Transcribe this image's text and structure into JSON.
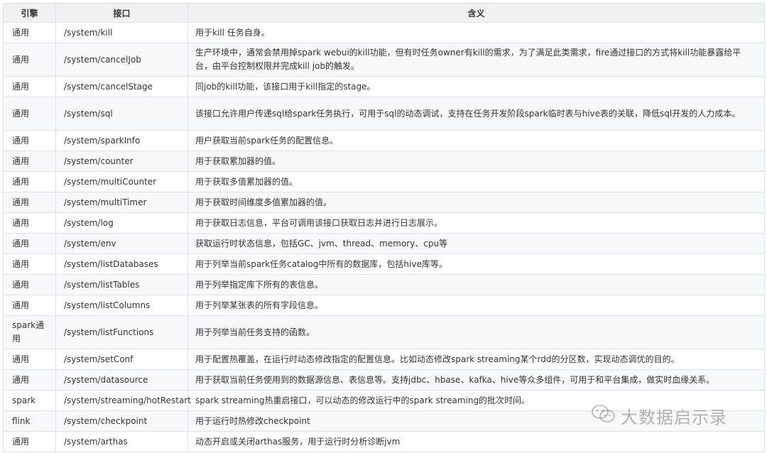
{
  "table": {
    "headers": [
      "引擎",
      "接口",
      "含义"
    ],
    "rows": [
      {
        "engine": "通用",
        "api": "/system/kill",
        "desc": "用于kill 任务自身。"
      },
      {
        "engine": "通用",
        "api": "/system/cancelJob",
        "desc": "生产环境中，通常会禁用掉spark webui的kill功能，但有时任务owner有kill的需求，为了满足此类需求，fire通过接口的方式将kill功能暴露给平台，由平台控制权限并完成kill job的触发。"
      },
      {
        "engine": "通用",
        "api": "/system/cancelStage",
        "desc": "同job的kill功能，该接口用于kill指定的stage。"
      },
      {
        "engine": "通用",
        "api": "/system/sql",
        "desc": "该接口允许用户传递sql给spark任务执行，可用于sql的动态调试，支持在任务开发阶段spark临时表与hive表的关联，降低sql开发的人力成本。"
      },
      {
        "engine": "通用",
        "api": "/system/sparkInfo",
        "desc": "用户获取当前spark任务的配置信息。"
      },
      {
        "engine": "通用",
        "api": "/system/counter",
        "desc": "用于获取累加器的值。"
      },
      {
        "engine": "通用",
        "api": "/system/multiCounter",
        "desc": "用于获取多值累加器的值。"
      },
      {
        "engine": "通用",
        "api": "/system/multiTimer",
        "desc": "用于获取时间维度多值累加器的值。"
      },
      {
        "engine": "通用",
        "api": "/system/log",
        "desc": "用于获取日志信息，平台可调用该接口获取日志并进行日志展示。"
      },
      {
        "engine": "通用",
        "api": "/system/env",
        "desc": "获取运行时状态信息，包括GC、jvm、thread、memory、cpu等"
      },
      {
        "engine": "通用",
        "api": "/system/listDatabases",
        "desc": "用于列举当前spark任务catalog中所有的数据库，包括hive库等。"
      },
      {
        "engine": "通用",
        "api": "/system/listTables",
        "desc": "用于列举指定库下所有的表信息。"
      },
      {
        "engine": "通用",
        "api": "/system/listColumns",
        "desc": "用于列举某张表的所有字段信息。"
      },
      {
        "engine": "spark通用",
        "api": "/system/listFunctions",
        "desc": "用于列举当前任务支持的函数。"
      },
      {
        "engine": "通用",
        "api": "/system/setConf",
        "desc": "用于配置热覆盖，在运行时动态修改指定的配置信息。比如动态修改spark streaming某个rdd的分区数，实现动态调优的目的。"
      },
      {
        "engine": "通用",
        "api": "/system/datasource",
        "desc": "用于获取当前任务使用到的数据源信息、表信息等。支持jdbc、hbase、kafka、hive等众多组件，可用于和平台集成，做实时血缘关系。"
      },
      {
        "engine": "spark",
        "api": "/system/streaming/hotRestart",
        "desc": "spark streaming热重启接口，可以动态的修改运行中的spark streaming的批次时间。"
      },
      {
        "engine": "flink",
        "api": "/system/checkpoint",
        "desc": "用于运行时热修改checkpoint"
      },
      {
        "engine": "通用",
        "api": "/system/arthas",
        "desc": "动态开启或关闭arthas服务，用于运行时分析诊断jvm"
      }
    ]
  },
  "watermark": {
    "text": "大数据启示录",
    "icon": "wechat-icon"
  }
}
